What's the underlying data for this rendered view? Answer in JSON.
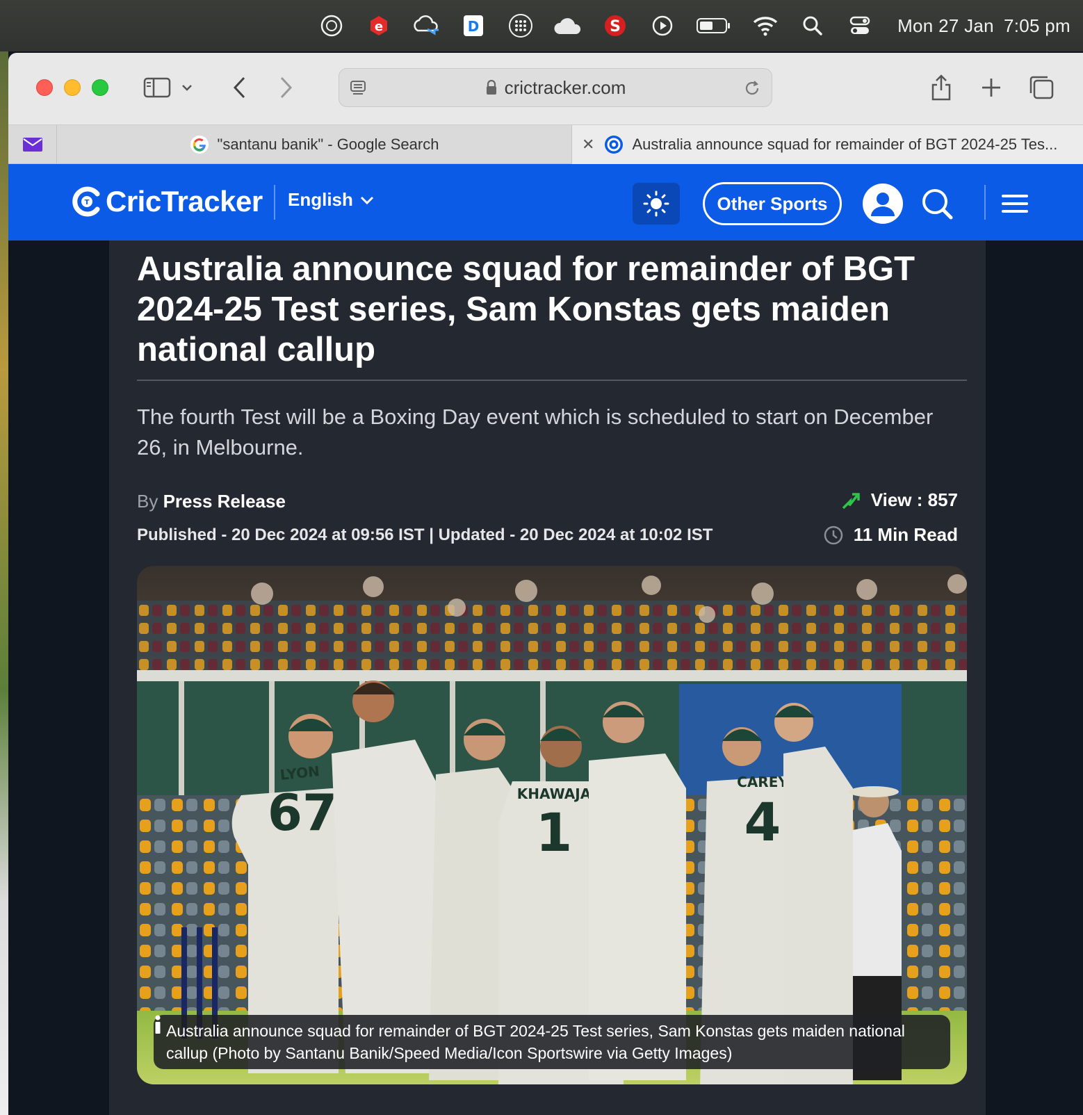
{
  "menubar": {
    "date": "Mon 27 Jan",
    "time": "7:05 pm",
    "icons": [
      "w-icon",
      "e-icon",
      "cloud-sync-icon",
      "d-icon",
      "dots-grid-icon",
      "cloud-icon",
      "s-icon",
      "play-icon",
      "battery-icon",
      "wifi-icon",
      "search-icon",
      "control-center-icon"
    ]
  },
  "browser": {
    "url": "crictracker.com",
    "tabs": [
      {
        "title": "\"santanu banik\" - Google Search"
      },
      {
        "title": "Australia announce squad for remainder of BGT 2024-25 Tes..."
      }
    ]
  },
  "site": {
    "logo": "CricTracker",
    "language": "English",
    "other_sports": "Other Sports",
    "brand_color": "#0b5be6"
  },
  "article": {
    "headline": "Australia announce squad for remainder of BGT 2024-25 Test series, Sam Konstas gets maiden national callup",
    "subtitle": "The fourth Test will be a Boxing Day event which is scheduled to start on December 26, in Melbourne.",
    "by_label": "By",
    "author": "Press Release",
    "published": "Published - 20 Dec 2024 at 09:56 IST | Updated - 20 Dec 2024 at 10:02 IST",
    "views": "View : 857",
    "read_time": "11 Min Read",
    "image_caption": "Australia announce squad for remainder of BGT 2024-25 Test series, Sam Konstas gets maiden national callup (Photo by Santanu Banik/Speed Media/Icon Sportswire via Getty Images)",
    "jersey_names": [
      "LYON",
      "KHAWAJA",
      "CAREY"
    ],
    "jersey_numbers": [
      "67",
      "1",
      "4"
    ]
  }
}
